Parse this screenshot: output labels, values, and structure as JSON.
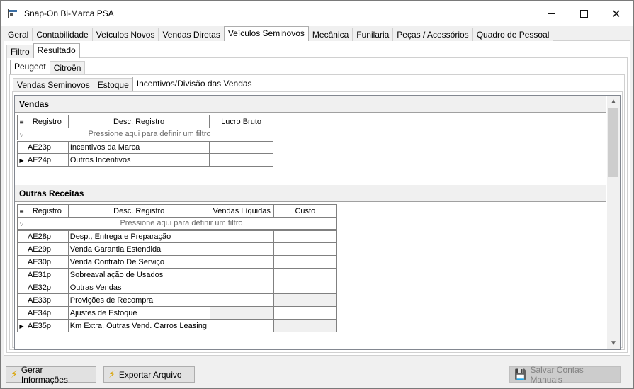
{
  "window": {
    "title": "Snap-On Bi-Marca PSA"
  },
  "main_tabs": [
    "Geral",
    "Contabilidade",
    "Veículos Novos",
    "Vendas Diretas",
    "Veículos Seminovos",
    "Mecânica",
    "Funilaria",
    "Peças / Acessórios",
    "Quadro de Pessoal"
  ],
  "sub_tabs": [
    "Filtro",
    "Resultado"
  ],
  "brand_tabs": [
    "Peugeot",
    "Citroën"
  ],
  "view_tabs": [
    "Vendas Seminovos",
    "Estoque",
    "Incentivos/Divisão das Vendas"
  ],
  "vendas": {
    "title": "Vendas",
    "columns": [
      "Registro",
      "Desc. Registro",
      "Lucro Bruto"
    ],
    "filter_text": "Pressione aqui para definir um filtro",
    "rows": [
      {
        "registro": "AE23p",
        "desc": "Incentivos da Marca"
      },
      {
        "registro": "AE24p",
        "desc": "Outros Incentivos"
      }
    ]
  },
  "outras": {
    "title": "Outras Receitas",
    "columns": [
      "Registro",
      "Desc. Registro",
      "Vendas Líquidas",
      "Custo"
    ],
    "filter_text": "Pressione aqui para definir um filtro",
    "rows": [
      {
        "registro": "AE28p",
        "desc": "Desp., Entrega e Preparação"
      },
      {
        "registro": "AE29p",
        "desc": "Venda Garantia Estendida"
      },
      {
        "registro": "AE30p",
        "desc": "Venda Contrato De Serviço"
      },
      {
        "registro": "AE31p",
        "desc": "Sobreavaliação de Usados"
      },
      {
        "registro": "AE32p",
        "desc": "Outras Vendas"
      },
      {
        "registro": "AE33p",
        "desc": "Provições de Recompra"
      },
      {
        "registro": "AE34p",
        "desc": "Ajustes de Estoque"
      },
      {
        "registro": "AE35p",
        "desc": "Km Extra, Outras Vend. Carros Leasing"
      }
    ]
  },
  "buttons": {
    "gerar": "Gerar Informações",
    "exportar": "Exportar Arquivo",
    "salvar": "Salvar Contas Manuais"
  }
}
